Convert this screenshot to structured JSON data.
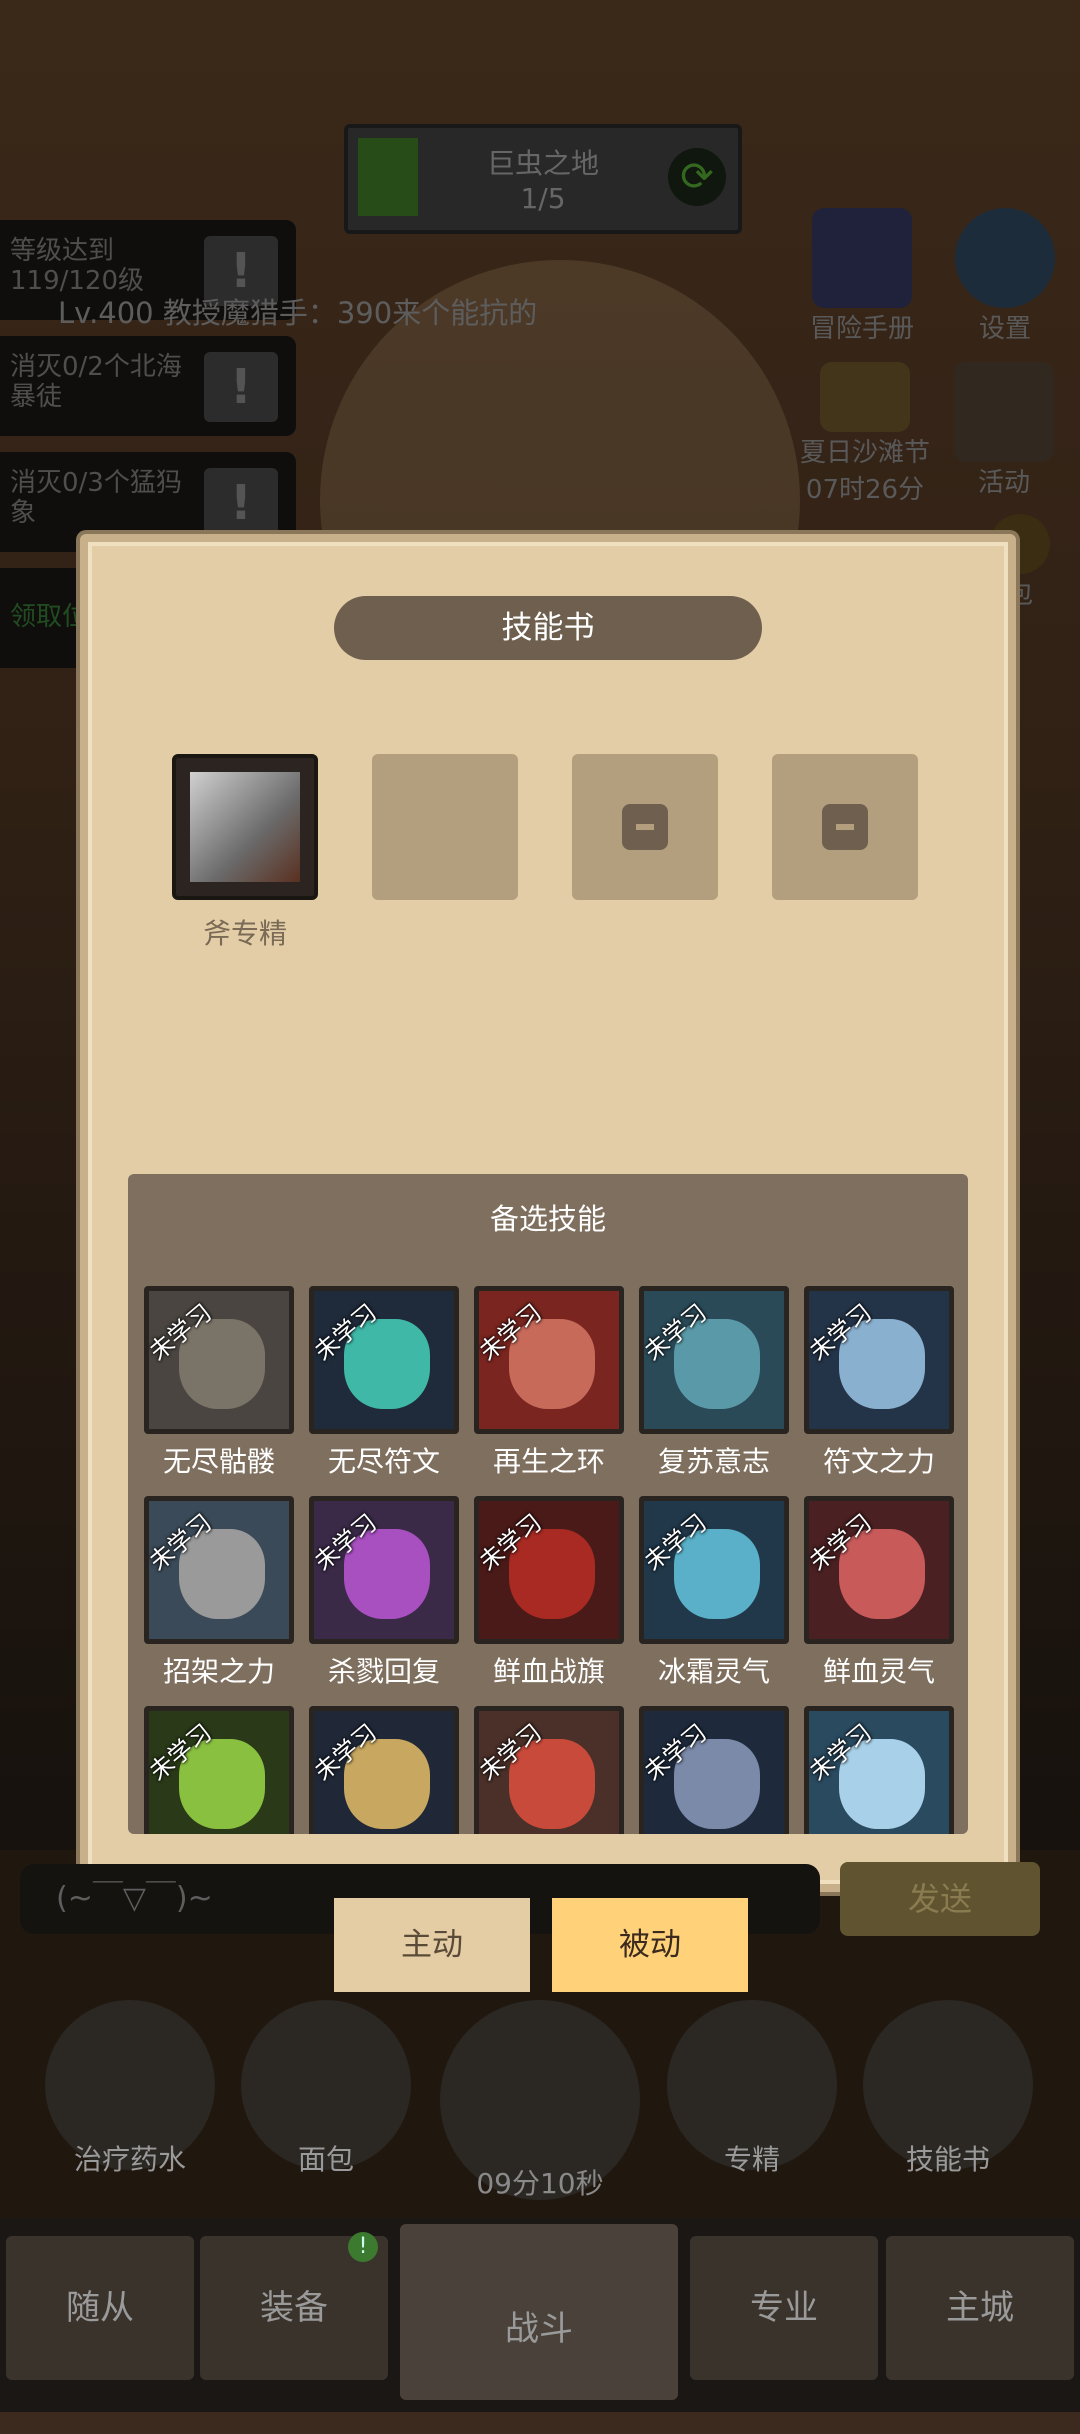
{
  "stage": {
    "name": "巨虫之地",
    "progress": "1/5",
    "progress_fraction": 0.2
  },
  "ticker": "Lv.400 教授魔猎手：390来个能抗的",
  "quests": [
    {
      "text": "等级达到119/120级"
    },
    {
      "text": "消灭0/2个北海暴徒"
    },
    {
      "text": "消灭0/3个猛犸象"
    },
    {
      "text": "领取位"
    }
  ],
  "right_tools": [
    {
      "label": "冒险手册",
      "icon": "book-icon"
    },
    {
      "label": "设置",
      "icon": "gear-icon"
    },
    {
      "label": "夏日沙滩节",
      "sub": "07时26分",
      "icon": "hat-icon"
    },
    {
      "label": "活动",
      "icon": "scroll-icon"
    },
    {
      "label": "包",
      "icon": "bag-icon"
    }
  ],
  "dialog": {
    "title": "技能书",
    "equipped": [
      {
        "name": "斧专精"
      }
    ],
    "pool_title": "备选技能",
    "unlearned_tag": "未学习",
    "skills": [
      {
        "name": "无尽骷髅",
        "color": "#4a4540",
        "accent": "#7a7468"
      },
      {
        "name": "无尽符文",
        "color": "#1f2a3a",
        "accent": "#3fb8a8"
      },
      {
        "name": "再生之环",
        "color": "#7a2520",
        "accent": "#c86a5a"
      },
      {
        "name": "复苏意志",
        "color": "#2a4a58",
        "accent": "#5a9aa8"
      },
      {
        "name": "符文之力",
        "color": "#243448",
        "accent": "#8ab0d0"
      },
      {
        "name": "招架之力",
        "color": "#3a4a58",
        "accent": "#9a9a9a"
      },
      {
        "name": "杀戮回复",
        "color": "#3a2a48",
        "accent": "#a850c0"
      },
      {
        "name": "鲜血战旗",
        "color": "#4a1a18",
        "accent": "#a82a22"
      },
      {
        "name": "冰霜灵气",
        "color": "#20384a",
        "accent": "#5ab0c8"
      },
      {
        "name": "鲜血灵气",
        "color": "#4a2022",
        "accent": "#c85a5a"
      },
      {
        "name": "",
        "color": "#2a3a18",
        "accent": "#8ac040"
      },
      {
        "name": "",
        "color": "#202838",
        "accent": "#c8a860"
      },
      {
        "name": "",
        "color": "#4a3028",
        "accent": "#c84a3a"
      },
      {
        "name": "",
        "color": "#1e2a3c",
        "accent": "#7a8aa8"
      },
      {
        "name": "",
        "color": "#2a4a60",
        "accent": "#a8d0e8"
      }
    ]
  },
  "chat": {
    "placeholder": "(~￣▽￣)~",
    "send": "发送"
  },
  "tabs": {
    "active": "主动",
    "passive": "被动"
  },
  "quick_items": [
    {
      "label": "治疗药水"
    },
    {
      "label": "面包"
    },
    {
      "label": "专精"
    },
    {
      "label": "技能书"
    }
  ],
  "timer": "09分10秒",
  "nav": {
    "followers": "随从",
    "equipment": "装备",
    "battle": "战斗",
    "profession": "专业",
    "city": "主城",
    "badge": "!"
  }
}
